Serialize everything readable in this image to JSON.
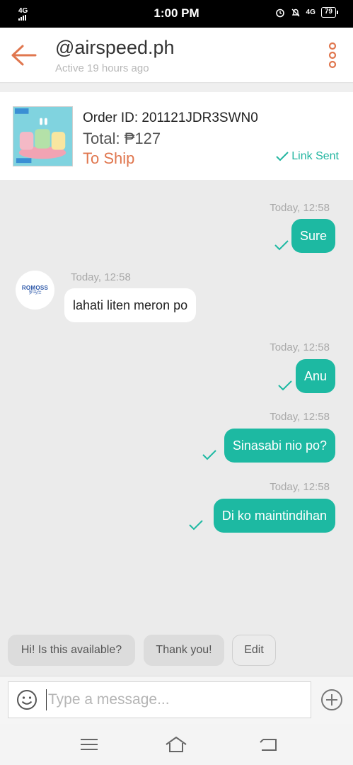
{
  "status_bar": {
    "network": "4G",
    "time": "1:00 PM",
    "signal_right": "4G",
    "battery": "79"
  },
  "header": {
    "title": "@airspeed.ph",
    "subtitle": "Active 19 hours ago"
  },
  "order": {
    "id_text": "Order ID: 201121JDR3SWN0",
    "total_text": "Total: ₱127",
    "status": "To Ship",
    "link_status": "Link Sent"
  },
  "avatar": {
    "brand": "ROMOSS",
    "sub": "罗马仕"
  },
  "messages": [
    {
      "direction": "out",
      "time": "Today, 12:58",
      "text": "Sure"
    },
    {
      "direction": "in",
      "time": "Today, 12:58",
      "text": "lahati liten meron po"
    },
    {
      "direction": "out",
      "time": "Today, 12:58",
      "text": "Anu"
    },
    {
      "direction": "out",
      "time": "Today, 12:58",
      "text": "Sinasabi nio po?"
    },
    {
      "direction": "out",
      "time": "Today, 12:58",
      "text": "Di ko maintindihan"
    }
  ],
  "quick_replies": [
    "Hi! Is this available?",
    "Thank you!",
    "Edit"
  ],
  "input": {
    "placeholder": "Type a message...",
    "value": ""
  },
  "colors": {
    "accent": "#1db9a2",
    "back_arrow": "#e0774f",
    "status_orange": "#e0774f"
  }
}
